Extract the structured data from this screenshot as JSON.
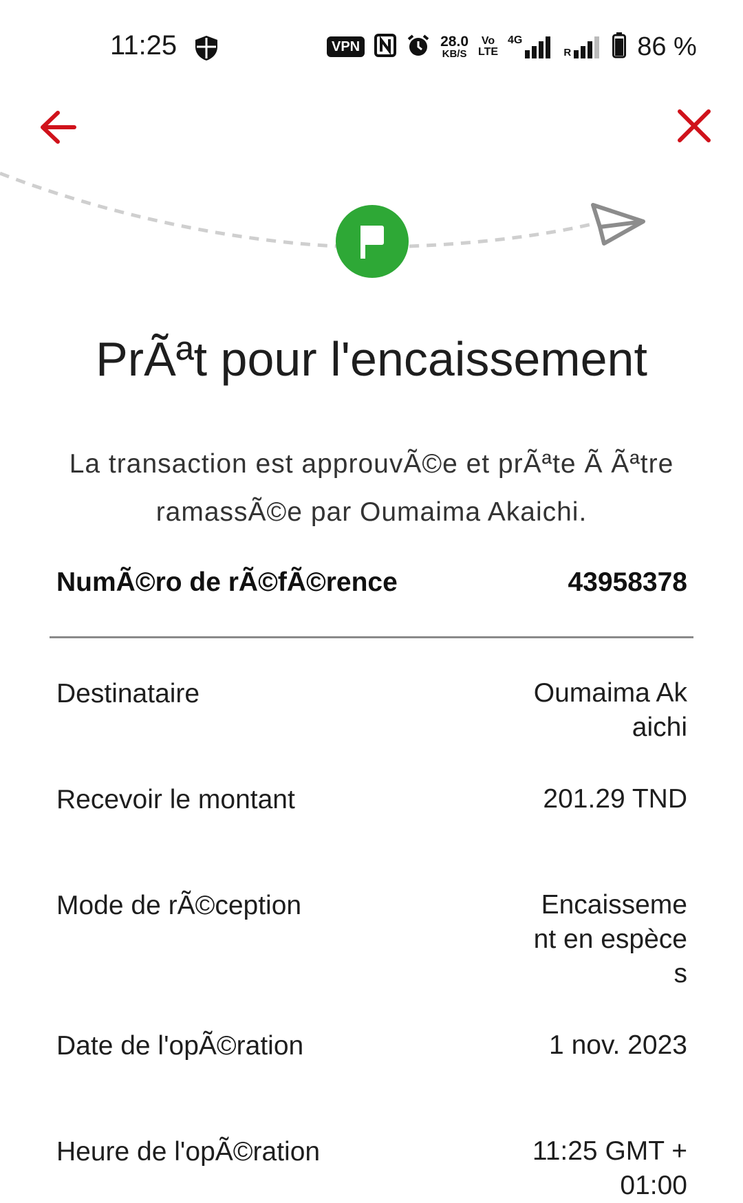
{
  "status_bar": {
    "time": "11:25",
    "vpn": "VPN",
    "network_speed_value": "28.0",
    "network_speed_unit": "KB/S",
    "volte_top": "Vo",
    "volte_bottom": "LTE",
    "network_type": "4G",
    "roaming": "R",
    "battery": "86 %"
  },
  "header": {
    "back_icon": "arrow-left-icon",
    "close_icon": "close-icon",
    "accent_color": "#d0121b"
  },
  "progress": {
    "status_icon": "flag-icon",
    "status_color": "#2ea836",
    "end_icon": "paper-plane-icon"
  },
  "title": "PrÃªt pour l'encaissement",
  "description": "La transaction est approuvÃ©e et prÃªte Ã Ãªtre ramassÃ©e par Oumaima Akaichi.",
  "reference": {
    "label": "NumÃ©ro de rÃ©fÃ©rence",
    "value": "43958378"
  },
  "details": [
    {
      "label": "Destinataire",
      "value": "Oumaima Akaichi"
    },
    {
      "label": "Recevoir le montant",
      "value": "201.29 TND"
    },
    {
      "label": "Mode de rÃ©ception",
      "value": "Encaissement en espèces"
    },
    {
      "label": "Date de l'opÃ©ration",
      "value": "1 nov. 2023"
    },
    {
      "label": "Heure de l'opÃ©ration",
      "value": "11:25 GMT +01:00"
    }
  ]
}
